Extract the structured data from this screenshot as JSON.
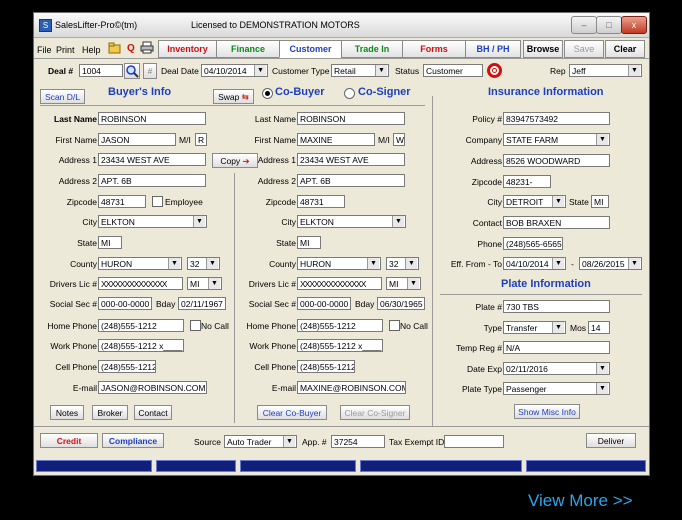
{
  "window": {
    "app_title": "SalesLifter-Pro©(tm)",
    "license": "Licensed to DEMONSTRATION MOTORS",
    "min": "–",
    "max": "□",
    "close": "x"
  },
  "menu": {
    "file": "File",
    "print": "Print",
    "help": "Help"
  },
  "tabs": {
    "inventory": "Inventory",
    "finance": "Finance",
    "customer": "Customer",
    "tradein": "Trade In",
    "forms": "Forms",
    "bhph": "BH / PH"
  },
  "toolbar": {
    "browse": "Browse",
    "save": "Save",
    "clear": "Clear",
    "q": "Q"
  },
  "deal": {
    "deal_label": "Deal #",
    "deal_value": "1004",
    "date_label": "Deal Date",
    "date_value": "04/10/2014",
    "type_label": "Customer Type",
    "type_value": "Retail",
    "status_label": "Status",
    "status_value": "Customer",
    "rep_label": "Rep",
    "rep_value": "Jeff",
    "hash": "#"
  },
  "buyer": {
    "scan": "Scan D/L",
    "title": "Buyer's Info",
    "swap": "Swap",
    "last_label": "Last Name",
    "last": "ROBINSON",
    "first_label": "First Name",
    "first": "JASON",
    "mi_label": "M/I",
    "mi": "R",
    "addr1_label": "Address 1",
    "addr1": "23434 WEST AVE",
    "addr2_label": "Address 2",
    "addr2": "APT. 6B",
    "zip_label": "Zipcode",
    "zip": "48731",
    "employee": "Employee",
    "city_label": "City",
    "city": "ELKTON",
    "state_label": "State",
    "state": "MI",
    "county_label": "County",
    "county": "HURON",
    "county_num": "32",
    "dl_label": "Drivers Lic #",
    "dl": "XXXXXXXXXXXXXX",
    "dl_state": "MI",
    "ssn_label": "Social Sec #",
    "ssn": "000-00-0000",
    "bday_label": "Bday",
    "bday": "02/11/1967",
    "home_label": "Home Phone",
    "home": "(248)555-1212",
    "nocall": "No Call",
    "work_label": "Work Phone",
    "work": "(248)555-1212 x____",
    "cell_label": "Cell Phone",
    "cell": "(248)555-1212",
    "email_label": "E-mail",
    "email": "JASON@ROBINSON.COM",
    "notes": "Notes",
    "broker": "Broker",
    "contact": "Contact",
    "credit": "Credit",
    "compliance": "Compliance"
  },
  "cobuyer": {
    "cobuyer": "Co-Buyer",
    "cosigner": "Co-Signer",
    "copy": "Copy",
    "last": "ROBINSON",
    "first": "MAXINE",
    "mi": "W",
    "addr1": "23434 WEST AVE",
    "addr2": "APT. 6B",
    "zip": "48731",
    "city": "ELKTON",
    "state": "MI",
    "county": "HURON",
    "county_num": "32",
    "dl": "XXXXXXXXXXXXXX",
    "dl_state": "MI",
    "ssn": "000-00-0000",
    "bday": "06/30/1965",
    "home": "(248)555-1212",
    "nocall": "No Call",
    "work": "(248)555-1212 x____",
    "cell": "(248)555-1212",
    "email": "MAXINE@ROBINSON.COM",
    "clear_cobuyer": "Clear Co-Buyer",
    "clear_cosigner": "Clear Co-Signer"
  },
  "insurance": {
    "title": "Insurance Information",
    "policy_label": "Policy #",
    "policy": "83947573492",
    "company_label": "Company",
    "company": "STATE FARM",
    "address_label": "Address",
    "address": "8526 WOODWARD",
    "zip_label": "Zipcode",
    "zip": "48231-",
    "city_label": "City",
    "city": "DETROIT",
    "state_label": "State",
    "state": "MI",
    "contact_label": "Contact",
    "contact": "BOB BRAXEN",
    "phone_label": "Phone",
    "phone": "(248)565-6565",
    "eff_label": "Eff. From - To",
    "eff_from": "04/10/2014",
    "dash": "-",
    "eff_to": "08/26/2015"
  },
  "plate": {
    "title": "Plate Information",
    "plate_label": "Plate #",
    "plate": "730 TBS",
    "type_label": "Type",
    "type": "Transfer",
    "mos_label": "Mos",
    "mos": "14",
    "temp_label": "Temp Reg #",
    "temp": "N/A",
    "exp_label": "Date Exp",
    "exp": "02/11/2016",
    "ptype_label": "Plate Type",
    "ptype": "Passenger",
    "misc": "Show Misc Info"
  },
  "footer": {
    "source_label": "Source",
    "source": "Auto Trader",
    "app_label": "App. #",
    "app": "37254",
    "tax_label": "Tax Exempt ID",
    "tax": "",
    "deliver": "Deliver"
  },
  "promo": {
    "view_more": "View More >>"
  },
  "colors": {
    "accent_blue": "#1c3fbf",
    "red": "#d01010",
    "green": "#0a8a1a",
    "status_bar": "#0f1f7a",
    "link": "#29a6ee"
  }
}
